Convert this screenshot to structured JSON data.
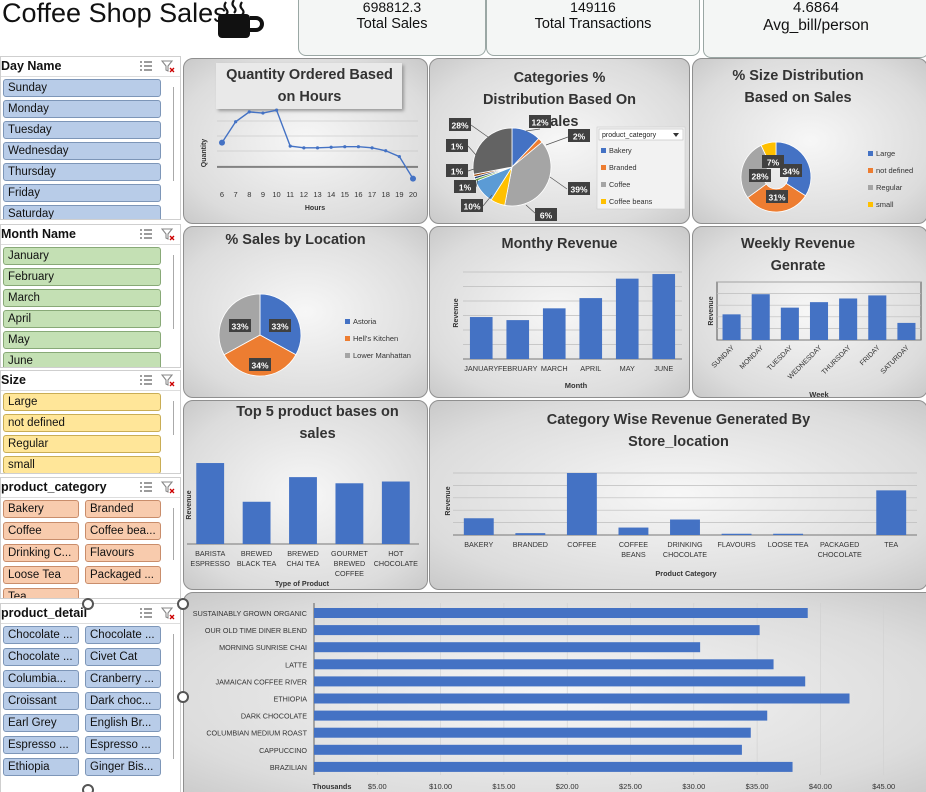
{
  "header": {
    "title": "Coffee Shop Sales",
    "kpis": [
      {
        "value": "698812.3",
        "label": "Total Sales"
      },
      {
        "value": "149116",
        "label": "Total Transactions"
      },
      {
        "value": "4.6864",
        "label": "Avg_bill/person"
      }
    ]
  },
  "slicers": {
    "day": {
      "title": "Day Name",
      "items": [
        "Sunday",
        "Monday",
        "Tuesday",
        "Wednesday",
        "Thursday",
        "Friday",
        "Saturday"
      ]
    },
    "month": {
      "title": "Month Name",
      "items": [
        "January",
        "February",
        "March",
        "April",
        "May",
        "June"
      ]
    },
    "size": {
      "title": "Size",
      "items": [
        "Large",
        "not defined",
        "Regular",
        "small"
      ]
    },
    "category": {
      "title": "product_category",
      "items": [
        "Bakery",
        "Branded",
        "Coffee",
        "Coffee bea...",
        "Drinking C...",
        "Flavours",
        "Loose Tea",
        "Packaged ...",
        "Tea"
      ]
    },
    "detail": {
      "title": "product_detail",
      "items": [
        "Chocolate ...",
        "Chocolate ...",
        "Chocolate ...",
        "Civet Cat",
        "Columbia...",
        "Cranberry ...",
        "Croissant",
        "Dark choc...",
        "Earl Grey",
        "English Br...",
        "Espresso ...",
        "Espresso ...",
        "Ethiopia",
        "Ginger Bis..."
      ]
    }
  },
  "colors": {
    "blue": "#4472c4",
    "orange": "#ed7d31",
    "gray": "#a5a5a5",
    "yellow": "#ffc000",
    "dark": "#595959",
    "lightblue": "#5b9bd5",
    "green": "#70ad47"
  },
  "charts": {
    "hours": {
      "title": "Quantity Ordered Based on Hours",
      "xlabel": "Hours",
      "ylabel": "Quantity",
      "x": [
        "6",
        "7",
        "8",
        "9",
        "10",
        "11",
        "12",
        "13",
        "14",
        "15",
        "16",
        "17",
        "18",
        "19",
        "20"
      ],
      "y": [
        0.42,
        0.78,
        0.95,
        0.93,
        0.98,
        0.36,
        0.33,
        0.33,
        0.34,
        0.35,
        0.35,
        0.33,
        0.28,
        0.18,
        -0.2
      ]
    },
    "categories": {
      "title": "Categories % Distribution Based On Sales",
      "legend_title": "product_category",
      "legend": [
        "Bakery",
        "Branded",
        "Coffee",
        "Coffee beans"
      ],
      "slices": [
        {
          "label": "12%",
          "value": 12,
          "color": "#4472c4"
        },
        {
          "label": "2%",
          "value": 2,
          "color": "#ed7d31"
        },
        {
          "label": "39%",
          "value": 39,
          "color": "#a5a5a5"
        },
        {
          "label": "6%",
          "value": 6,
          "color": "#ffc000"
        },
        {
          "label": "10%",
          "value": 10,
          "color": "#5b9bd5"
        },
        {
          "label": "1%",
          "value": 1,
          "color": "#70ad47"
        },
        {
          "label": "1%",
          "value": 1,
          "color": "#264478"
        },
        {
          "label": "1%",
          "value": 1,
          "color": "#9e480e"
        },
        {
          "label": "28%",
          "value": 28,
          "color": "#636363"
        }
      ]
    },
    "size": {
      "title": "% Size Distribution Based on Sales",
      "legend": [
        "Large",
        "not defined",
        "Regular",
        "small"
      ],
      "slices": [
        {
          "label": "34%",
          "value": 34,
          "color": "#4472c4"
        },
        {
          "label": "31%",
          "value": 31,
          "color": "#ed7d31"
        },
        {
          "label": "28%",
          "value": 28,
          "color": "#a5a5a5"
        },
        {
          "label": "7%",
          "value": 7,
          "color": "#ffc000"
        }
      ]
    },
    "location": {
      "title": "% Sales by Location",
      "legend": [
        "Astoria",
        "Hell's Kitchen",
        "Lower Manhattan"
      ],
      "slices": [
        {
          "label": "33%",
          "value": 33,
          "color": "#4472c4"
        },
        {
          "label": "34%",
          "value": 34,
          "color": "#ed7d31"
        },
        {
          "label": "33%",
          "value": 33,
          "color": "#a5a5a5"
        }
      ]
    },
    "monthly": {
      "title": "Monthy Revenue",
      "xlabel": "Month",
      "ylabel": "Revenue",
      "categories": [
        "JANUARY",
        "FEBRUARY",
        "MARCH",
        "APRIL",
        "MAY",
        "JUNE"
      ],
      "values": [
        82000,
        76000,
        99000,
        119000,
        157000,
        166000
      ]
    },
    "weekly": {
      "title": "Weekly Revenue Genrate",
      "xlabel": "Week",
      "ylabel": "Revenue",
      "categories": [
        "SUNDAY",
        "MONDAY",
        "TUESDAY",
        "WEDNESDAY",
        "THURSDAY",
        "FRIDAY",
        "SATURDAY"
      ],
      "values": [
        0.42,
        0.75,
        0.53,
        0.62,
        0.68,
        0.73,
        0.28
      ]
    },
    "top5": {
      "title": "Top 5 product bases on sales",
      "xlabel": "Type of Product",
      "ylabel": "Revenue",
      "categories": [
        "BARISTA ESPRESSO",
        "BREWED BLACK TEA",
        "BREWED CHAI TEA",
        "GOURMET BREWED COFFEE",
        "HOT CHOCOLATE"
      ],
      "values": [
        0.92,
        0.48,
        0.76,
        0.69,
        0.71
      ]
    },
    "catloc": {
      "title": "Category Wise Revenue Generated By Store_location",
      "xlabel": "Product Category",
      "ylabel": "Revenue",
      "categories": [
        "BAKERY",
        "BRANDED",
        "COFFEE",
        "COFFEE BEANS",
        "DRINKING CHOCOLATE",
        "FLAVOURS",
        "LOOSE TEA",
        "PACKAGED CHOCOLATE",
        "TEA"
      ],
      "values": [
        0.27,
        0.03,
        1.0,
        0.12,
        0.25,
        0.02,
        0.02,
        0.0,
        0.72
      ]
    },
    "products": {
      "xlabel": "Thousands",
      "ticks": [
        "$5.00",
        "$10.00",
        "$15.00",
        "$20.00",
        "$25.00",
        "$30.00",
        "$35.00",
        "$40.00",
        "$45.00"
      ],
      "categories": [
        "SUSTAINABLY GROWN ORGANIC",
        "OUR OLD TIME DINER BLEND",
        "MORNING SUNRISE CHAI",
        "LATTE",
        "JAMAICAN COFFEE RIVER",
        "ETHIOPIA",
        "DARK CHOCOLATE",
        "COLUMBIAN MEDIUM ROAST",
        "CAPPUCCINO",
        "BRAZILIAN"
      ],
      "values": [
        39.0,
        35.2,
        30.5,
        36.3,
        38.8,
        42.3,
        35.8,
        34.5,
        33.8,
        37.8
      ]
    }
  }
}
